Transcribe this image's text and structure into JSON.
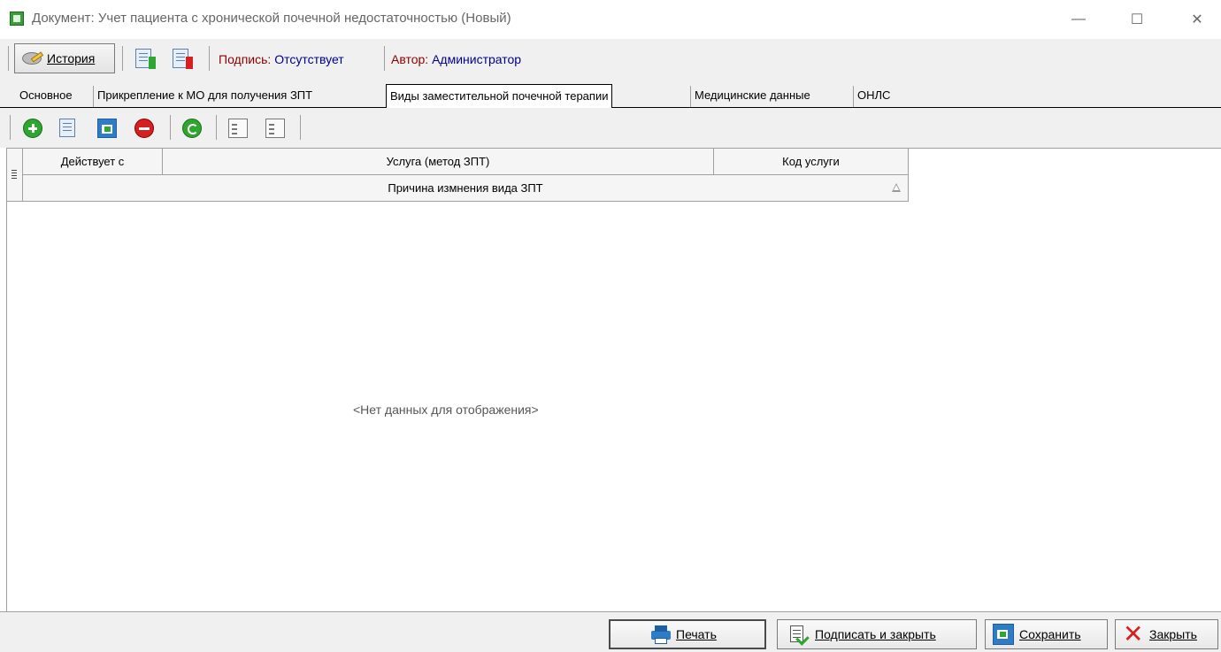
{
  "window": {
    "title": "Документ: Учет пациента с хронической почечной недостаточностью (Новый)",
    "minimize_glyph": "—",
    "maximize_glyph": "☐",
    "close_glyph": "✕"
  },
  "toolbar": {
    "history_label": "История",
    "sign_key": "Подпись:",
    "sign_value": "Отсутствует",
    "author_key": "Автор:",
    "author_value": "Администратор"
  },
  "tabs": [
    {
      "label": "Основное",
      "active": false
    },
    {
      "label": "Прикрепление к МО для получения ЗПТ",
      "active": false
    },
    {
      "label": "Виды заместительной почечной терапии",
      "active": true
    },
    {
      "label": "Медицинские данные",
      "active": false
    },
    {
      "label": "ОНЛС",
      "active": false
    }
  ],
  "grid_toolbar": {
    "icons": [
      "add-icon",
      "edit-icon",
      "save-icon",
      "delete-icon",
      "refresh-icon",
      "expand-tree-icon",
      "collapse-tree-icon"
    ]
  },
  "grid": {
    "columns": [
      "Действует с",
      "Услуга (метод ЗПТ)",
      "Код услуги"
    ],
    "second_row_header": "Причина измнения вида ЗПТ",
    "empty_text": "<Нет данных для отображения>"
  },
  "footer": {
    "print_label": "Печать",
    "sign_close_label": "Подписать и закрыть",
    "save_label": "Сохранить",
    "close_label": "Закрыть"
  },
  "colors": {
    "accent_green": "#2fa62f",
    "danger_red": "#d42020",
    "key_text": "#8b0000",
    "value_text": "#00008b"
  }
}
